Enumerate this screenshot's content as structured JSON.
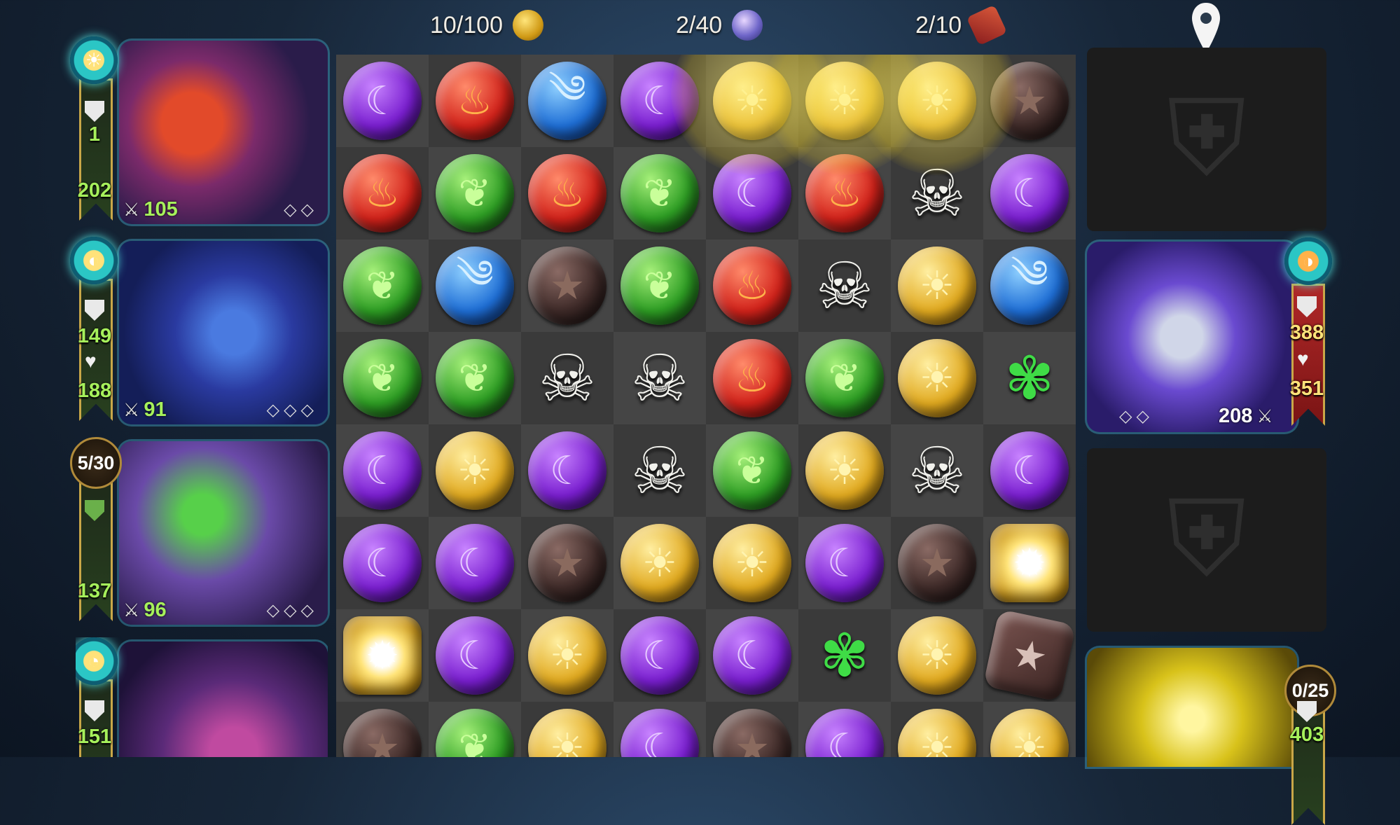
{
  "resources": {
    "gold": "10/100",
    "souls": "2/40",
    "maps": "2/10"
  },
  "icons": {
    "gold": "gold-coins-icon",
    "souls": "soul-orb-icon",
    "maps": "treasure-map-icon",
    "marker": "location-marker-icon"
  },
  "heroes": [
    {
      "armor": "1",
      "life": "202",
      "attack": "105",
      "badge": "sun-mana-icon"
    },
    {
      "armor": "149",
      "life": "188",
      "attack": "91",
      "badge": "mana-icon"
    },
    {
      "counter": "5/30",
      "life": "137",
      "attack": "96"
    },
    {
      "armor": "151"
    }
  ],
  "enemy": {
    "armor": "388",
    "life": "351",
    "attack": "208"
  },
  "ally_right": {
    "counter": "0/25",
    "life": "403"
  },
  "board": {
    "rows": [
      [
        "purple",
        "red",
        "blue",
        "purple",
        "yellow",
        "yellow",
        "yellow",
        "brown"
      ],
      [
        "red",
        "green",
        "red",
        "green",
        "purple",
        "red",
        "skull",
        "purple"
      ],
      [
        "green",
        "blue",
        "brown",
        "green",
        "red",
        "skull",
        "yellow",
        "blue"
      ],
      [
        "green",
        "green",
        "skull",
        "skull",
        "red",
        "green",
        "yellow",
        "butterfly"
      ],
      [
        "purple",
        "yellow",
        "purple",
        "skull",
        "green",
        "yellow",
        "skull",
        "purple"
      ],
      [
        "purple",
        "purple",
        "brown",
        "yellow",
        "yellow",
        "purple",
        "brown",
        "sunburst"
      ],
      [
        "sunburst",
        "purple",
        "yellow",
        "purple",
        "purple",
        "butterfly",
        "yellow",
        "rock"
      ],
      [
        "brown",
        "green",
        "yellow",
        "purple",
        "brown",
        "purple",
        "yellow",
        "yellow"
      ]
    ]
  },
  "colors": {
    "purple": "#7a1fd0",
    "red": "#d2231b",
    "blue": "#1f6fd6",
    "green": "#2e9e24",
    "brown": "#3e2a28",
    "yellow": "#e1aa20",
    "accent_green": "#a6f05b",
    "accent_gold": "#ffe27a"
  }
}
